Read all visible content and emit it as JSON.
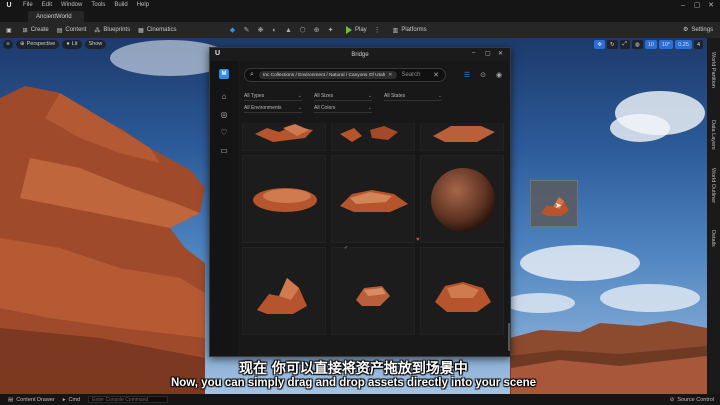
{
  "menu": {
    "items": [
      "File",
      "Edit",
      "Window",
      "Tools",
      "Build",
      "Help"
    ]
  },
  "project_tab": "AncientWorld",
  "toolbar": {
    "left_items": [
      "Create",
      "Content",
      "Blueprints",
      "Cinematics"
    ],
    "play_label": "Play",
    "platforms_label": "Platforms",
    "settings_label": "Settings"
  },
  "viewport": {
    "perspective_label": "Perspective",
    "lit_label": "Lit",
    "show_label": "Show",
    "snap_values": [
      "10",
      "10°",
      "0.25",
      "4"
    ]
  },
  "side_tabs": [
    "World Partition",
    "Data Layers",
    "World Outliner",
    "Details"
  ],
  "bridge": {
    "title": "Bridge",
    "search": {
      "chip": "Inc Collections / Environment / Natural / Canyons Of Utah",
      "placeholder": "Search"
    },
    "filters": [
      "All Types",
      "All Sizes",
      "All States",
      "All Environments",
      "All Colors"
    ]
  },
  "status": {
    "content_drawer": "Content Drawer",
    "cmd_label": "Cmd",
    "cmd_placeholder": "Enter Console Command",
    "source_control": "Source Control"
  },
  "subtitles": {
    "cn": "现在 你可以直接将资产拖放到场景中",
    "en": "Now, you can simply drag and drop assets directly into your scene"
  },
  "colors": {
    "accent_blue": "#2a8ce8",
    "play_green": "#6bbf3c",
    "favorite_red": "#e0443e",
    "rock": "#b5542d"
  }
}
